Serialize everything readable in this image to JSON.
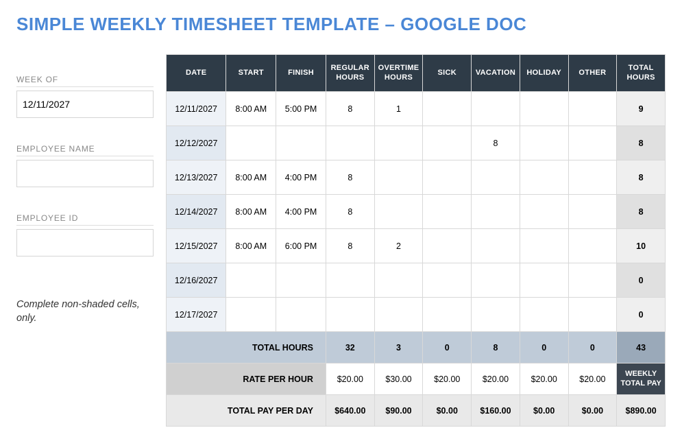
{
  "title": "SIMPLE WEEKLY TIMESHEET TEMPLATE – GOOGLE DOC",
  "left": {
    "weekof_label": "WEEK OF",
    "weekof_value": "12/11/2027",
    "empname_label": "EMPLOYEE NAME",
    "empname_value": "",
    "empid_label": "EMPLOYEE ID",
    "empid_value": "",
    "note": "Complete non-shaded cells, only."
  },
  "headers": {
    "date": "DATE",
    "start": "START",
    "finish": "FINISH",
    "regular": "REGULAR HOURS",
    "overtime": "OVERTIME HOURS",
    "sick": "SICK",
    "vacation": "VACATION",
    "holiday": "HOLIDAY",
    "other": "OTHER",
    "total": "TOTAL HOURS"
  },
  "rows": [
    {
      "date": "12/11/2027",
      "start": "8:00 AM",
      "finish": "5:00 PM",
      "regular": "8",
      "overtime": "1",
      "sick": "",
      "vacation": "",
      "holiday": "",
      "other": "",
      "total": "9"
    },
    {
      "date": "12/12/2027",
      "start": "",
      "finish": "",
      "regular": "",
      "overtime": "",
      "sick": "",
      "vacation": "8",
      "holiday": "",
      "other": "",
      "total": "8"
    },
    {
      "date": "12/13/2027",
      "start": "8:00 AM",
      "finish": "4:00 PM",
      "regular": "8",
      "overtime": "",
      "sick": "",
      "vacation": "",
      "holiday": "",
      "other": "",
      "total": "8"
    },
    {
      "date": "12/14/2027",
      "start": "8:00 AM",
      "finish": "4:00 PM",
      "regular": "8",
      "overtime": "",
      "sick": "",
      "vacation": "",
      "holiday": "",
      "other": "",
      "total": "8"
    },
    {
      "date": "12/15/2027",
      "start": "8:00 AM",
      "finish": "6:00 PM",
      "regular": "8",
      "overtime": "2",
      "sick": "",
      "vacation": "",
      "holiday": "",
      "other": "",
      "total": "10"
    },
    {
      "date": "12/16/2027",
      "start": "",
      "finish": "",
      "regular": "",
      "overtime": "",
      "sick": "",
      "vacation": "",
      "holiday": "",
      "other": "",
      "total": "0"
    },
    {
      "date": "12/17/2027",
      "start": "",
      "finish": "",
      "regular": "",
      "overtime": "",
      "sick": "",
      "vacation": "",
      "holiday": "",
      "other": "",
      "total": "0"
    }
  ],
  "totals": {
    "label_total_hours": "TOTAL HOURS",
    "regular": "32",
    "overtime": "3",
    "sick": "0",
    "vacation": "8",
    "holiday": "0",
    "other": "0",
    "grand": "43"
  },
  "rate": {
    "label": "RATE PER HOUR",
    "regular": "$20.00",
    "overtime": "$30.00",
    "sick": "$20.00",
    "vacation": "$20.00",
    "holiday": "$20.00",
    "other": "$20.00",
    "weekly_label": "WEEKLY TOTAL PAY"
  },
  "pay": {
    "label": "TOTAL PAY PER DAY",
    "regular": "$640.00",
    "overtime": "$90.00",
    "sick": "$0.00",
    "vacation": "$160.00",
    "holiday": "$0.00",
    "other": "$0.00",
    "grand": "$890.00"
  }
}
